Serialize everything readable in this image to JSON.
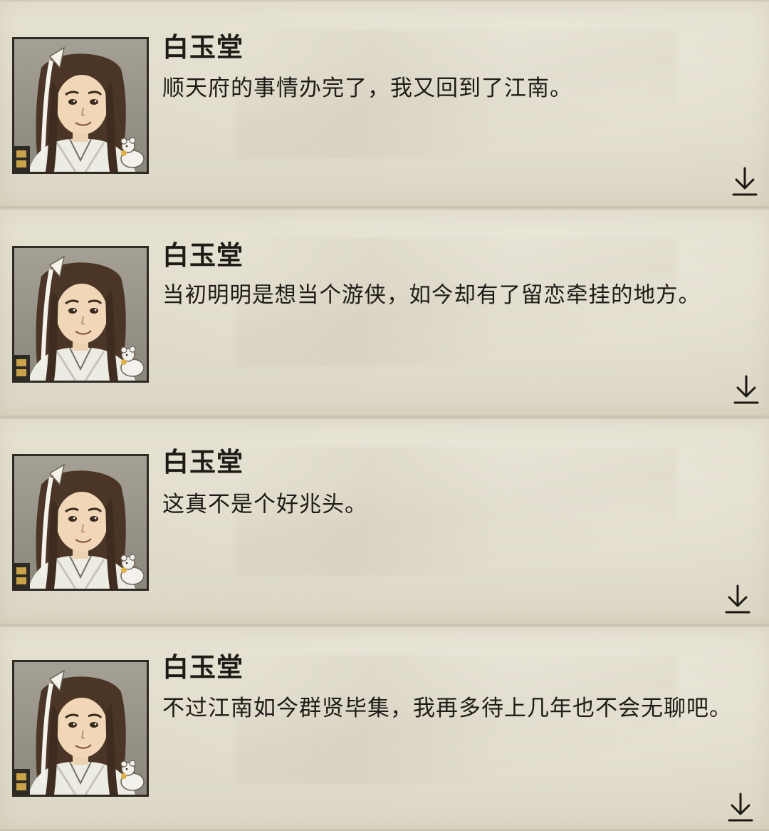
{
  "dialogues": [
    {
      "speaker": "白玉堂",
      "text": "顺天府的事情办完了，我又回到了江南。",
      "portrait_icon": "character-portrait",
      "next_icon": "arrow-down-icon"
    },
    {
      "speaker": "白玉堂",
      "text": "当初明明是想当个游侠，如今却有了留恋牵挂的地方。",
      "portrait_icon": "character-portrait",
      "next_icon": "arrow-down-icon"
    },
    {
      "speaker": "白玉堂",
      "text": "这真不是个好兆头。",
      "portrait_icon": "character-portrait",
      "next_icon": "arrow-down-icon"
    },
    {
      "speaker": "白玉堂",
      "text": "不过江南如今群贤毕集，我再多待上几年也不会无聊吧。",
      "portrait_icon": "character-portrait",
      "next_icon": "arrow-down-icon"
    }
  ],
  "colors": {
    "parchment": "#e3dfcf",
    "text": "#1f1b16",
    "portrait_frame": "#2f2a22"
  }
}
